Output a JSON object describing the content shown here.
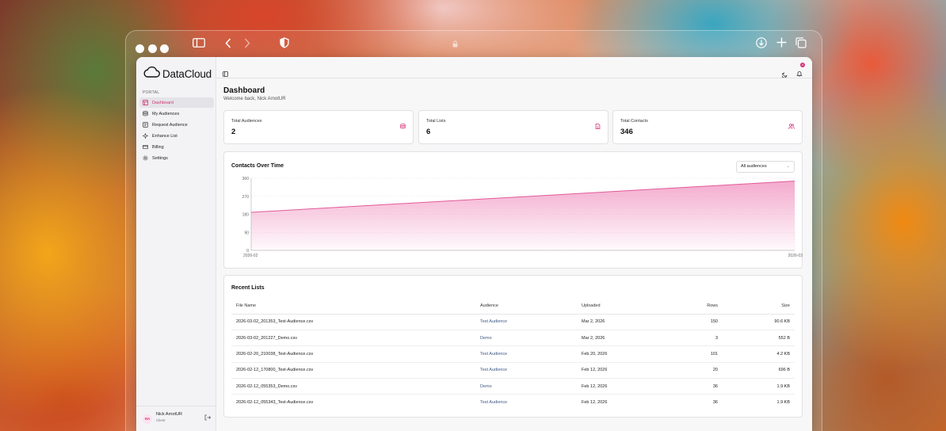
{
  "app": {
    "name": "DataCloud",
    "portal_label": "PORTAL"
  },
  "sidebar": {
    "items": [
      {
        "label": "Dashboard",
        "icon": "dashboard-icon",
        "active": true
      },
      {
        "label": "My Audiences",
        "icon": "database-icon",
        "active": false
      },
      {
        "label": "Request Audience",
        "icon": "request-icon",
        "active": false
      },
      {
        "label": "Enhance List",
        "icon": "sparkle-icon",
        "active": false
      },
      {
        "label": "Billing",
        "icon": "credit-card-icon",
        "active": false
      },
      {
        "label": "Settings",
        "icon": "gear-icon",
        "active": false
      }
    ],
    "user": {
      "initials": "NA",
      "name": "Nick ArnotUR",
      "role": "Client"
    }
  },
  "header": {
    "notification_count": "4"
  },
  "dashboard": {
    "title": "Dashboard",
    "welcome": "Welcome back, Nick ArnotUR"
  },
  "stats": [
    {
      "label": "Total Audiences",
      "value": "2",
      "icon": "database-icon"
    },
    {
      "label": "Total Lists",
      "value": "6",
      "icon": "file-icon"
    },
    {
      "label": "Total Contacts",
      "value": "346",
      "icon": "users-icon"
    }
  ],
  "chart": {
    "title": "Contacts Over Time",
    "filter_value": "All audiences"
  },
  "chart_data": {
    "type": "area",
    "title": "Contacts Over Time",
    "x": [
      "2026-02",
      "2026-03"
    ],
    "values": [
      190,
      346
    ],
    "yticks": [
      0,
      90,
      180,
      270,
      360
    ],
    "ylim": [
      0,
      360
    ],
    "xlabel": "",
    "ylabel": "",
    "grid": true,
    "color": "#f29bc4"
  },
  "recent_lists": {
    "title": "Recent Lists",
    "columns": [
      "File Name",
      "Audience",
      "Uploaded",
      "Rows",
      "Size"
    ],
    "rows": [
      [
        "2026-03-02_201353_Test-Audience.csv",
        "Test Audience",
        "Mar 2, 2026",
        "150",
        "90.6 KB"
      ],
      [
        "2026-03-02_201227_Demo.csv",
        "Demo",
        "Mar 2, 2026",
        "3",
        "552 B"
      ],
      [
        "2026-02-20_210038_Test-Audience.csv",
        "Test Audience",
        "Feb 20, 2026",
        "101",
        "4.2 KB"
      ],
      [
        "2026-02-12_170800_Test-Audience.csv",
        "Test Audience",
        "Feb 12, 2026",
        "20",
        "696 B"
      ],
      [
        "2026-02-12_055353_Demo.csv",
        "Demo",
        "Feb 12, 2026",
        "36",
        "1.9 KB"
      ],
      [
        "2026-02-12_055343_Test-Audience.csv",
        "Test Audience",
        "Feb 12, 2026",
        "36",
        "1.9 KB"
      ]
    ]
  },
  "colors": {
    "accent": "#d6337a"
  }
}
